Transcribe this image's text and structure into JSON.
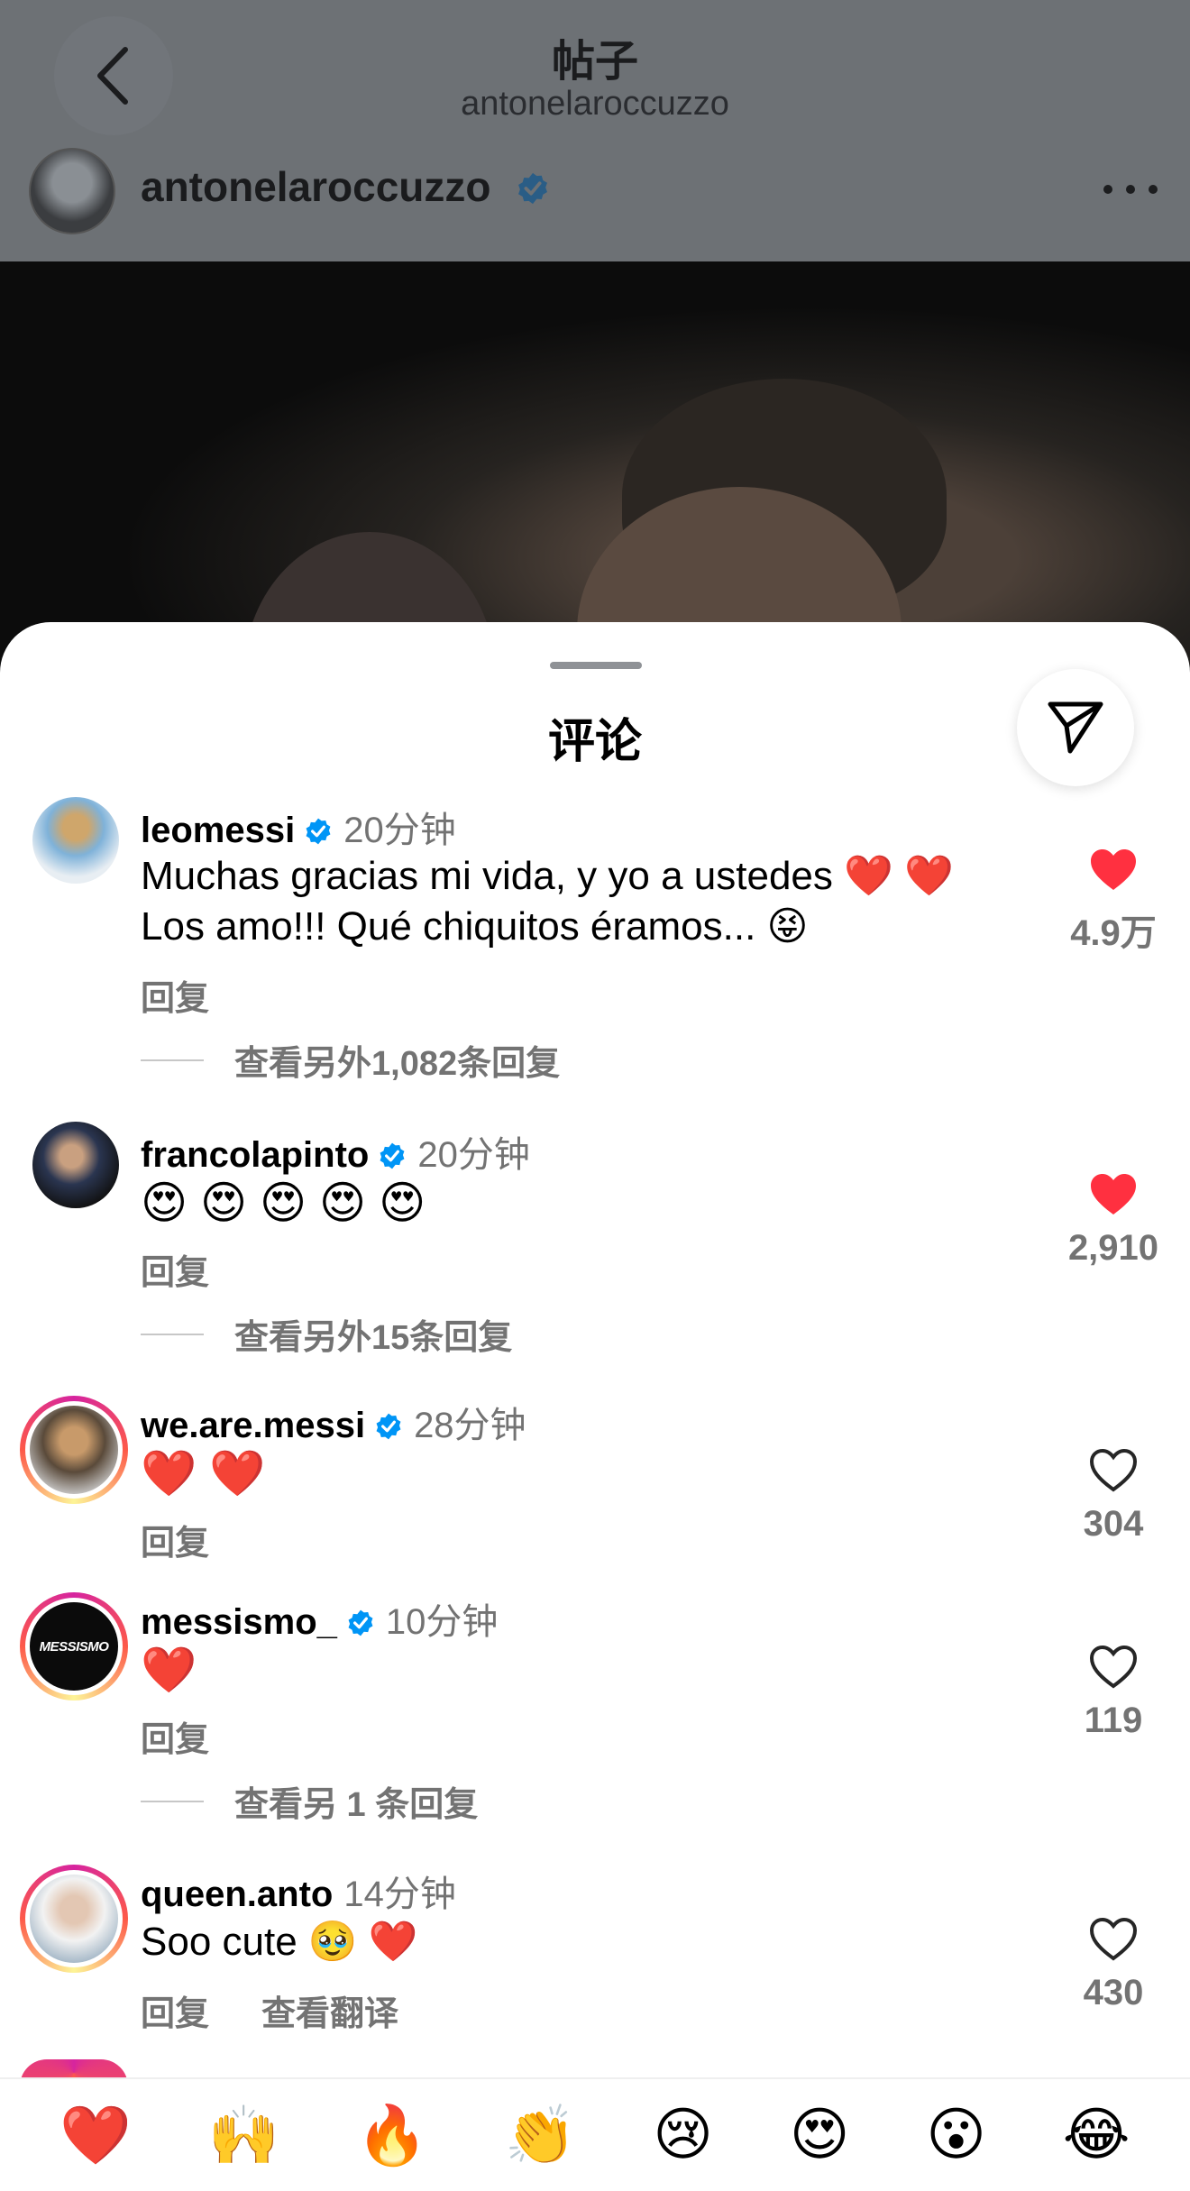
{
  "header": {
    "title": "帖子",
    "subtitle": "antonelaroccuzzo"
  },
  "post": {
    "author": "antonelaroccuzzo"
  },
  "sheet": {
    "title": "评论"
  },
  "comments": [
    {
      "user": "leomessi",
      "time": "20分钟",
      "text": "Muchas gracias mi vida, y yo a ustedes ❤️ ❤️ Los amo!!! Qué chiquitos éramos... 😝",
      "reply": "回复",
      "more": "查看另外1,082条回复",
      "likes": "4.9万",
      "liked": true
    },
    {
      "user": "francolapinto",
      "time": "20分钟",
      "text": "😍 😍 😍 😍 😍",
      "reply": "回复",
      "more": "查看另外15条回复",
      "likes": "2,910",
      "liked": true
    },
    {
      "user": "we.are.messi",
      "time": "28分钟",
      "text": "❤️ ❤️",
      "reply": "回复",
      "likes": "304",
      "liked": false
    },
    {
      "user": "messismo_",
      "time": "10分钟",
      "text": "❤️",
      "reply": "回复",
      "more": "查看另 1 条回复",
      "likes": "119",
      "liked": false,
      "avatar_text": "MESSISMO"
    },
    {
      "user": "queen.anto",
      "time": "14分钟",
      "text": "Soo cute 🥹 ❤️",
      "reply": "回复",
      "translate": "查看翻译",
      "likes": "430",
      "liked": false
    }
  ],
  "emoji_bar": [
    "❤️",
    "🙌",
    "🔥",
    "👏",
    "😢",
    "😍",
    "😮",
    "😂"
  ],
  "colors": {
    "verified": "#0095f6",
    "like": "#ff3040",
    "secondary_text": "#737373"
  },
  "icons": {
    "back": "chevron-left-icon",
    "verified": "verified-badge-icon",
    "more": "more-horizontal-icon",
    "share": "share-send-icon",
    "like": "heart-icon"
  }
}
